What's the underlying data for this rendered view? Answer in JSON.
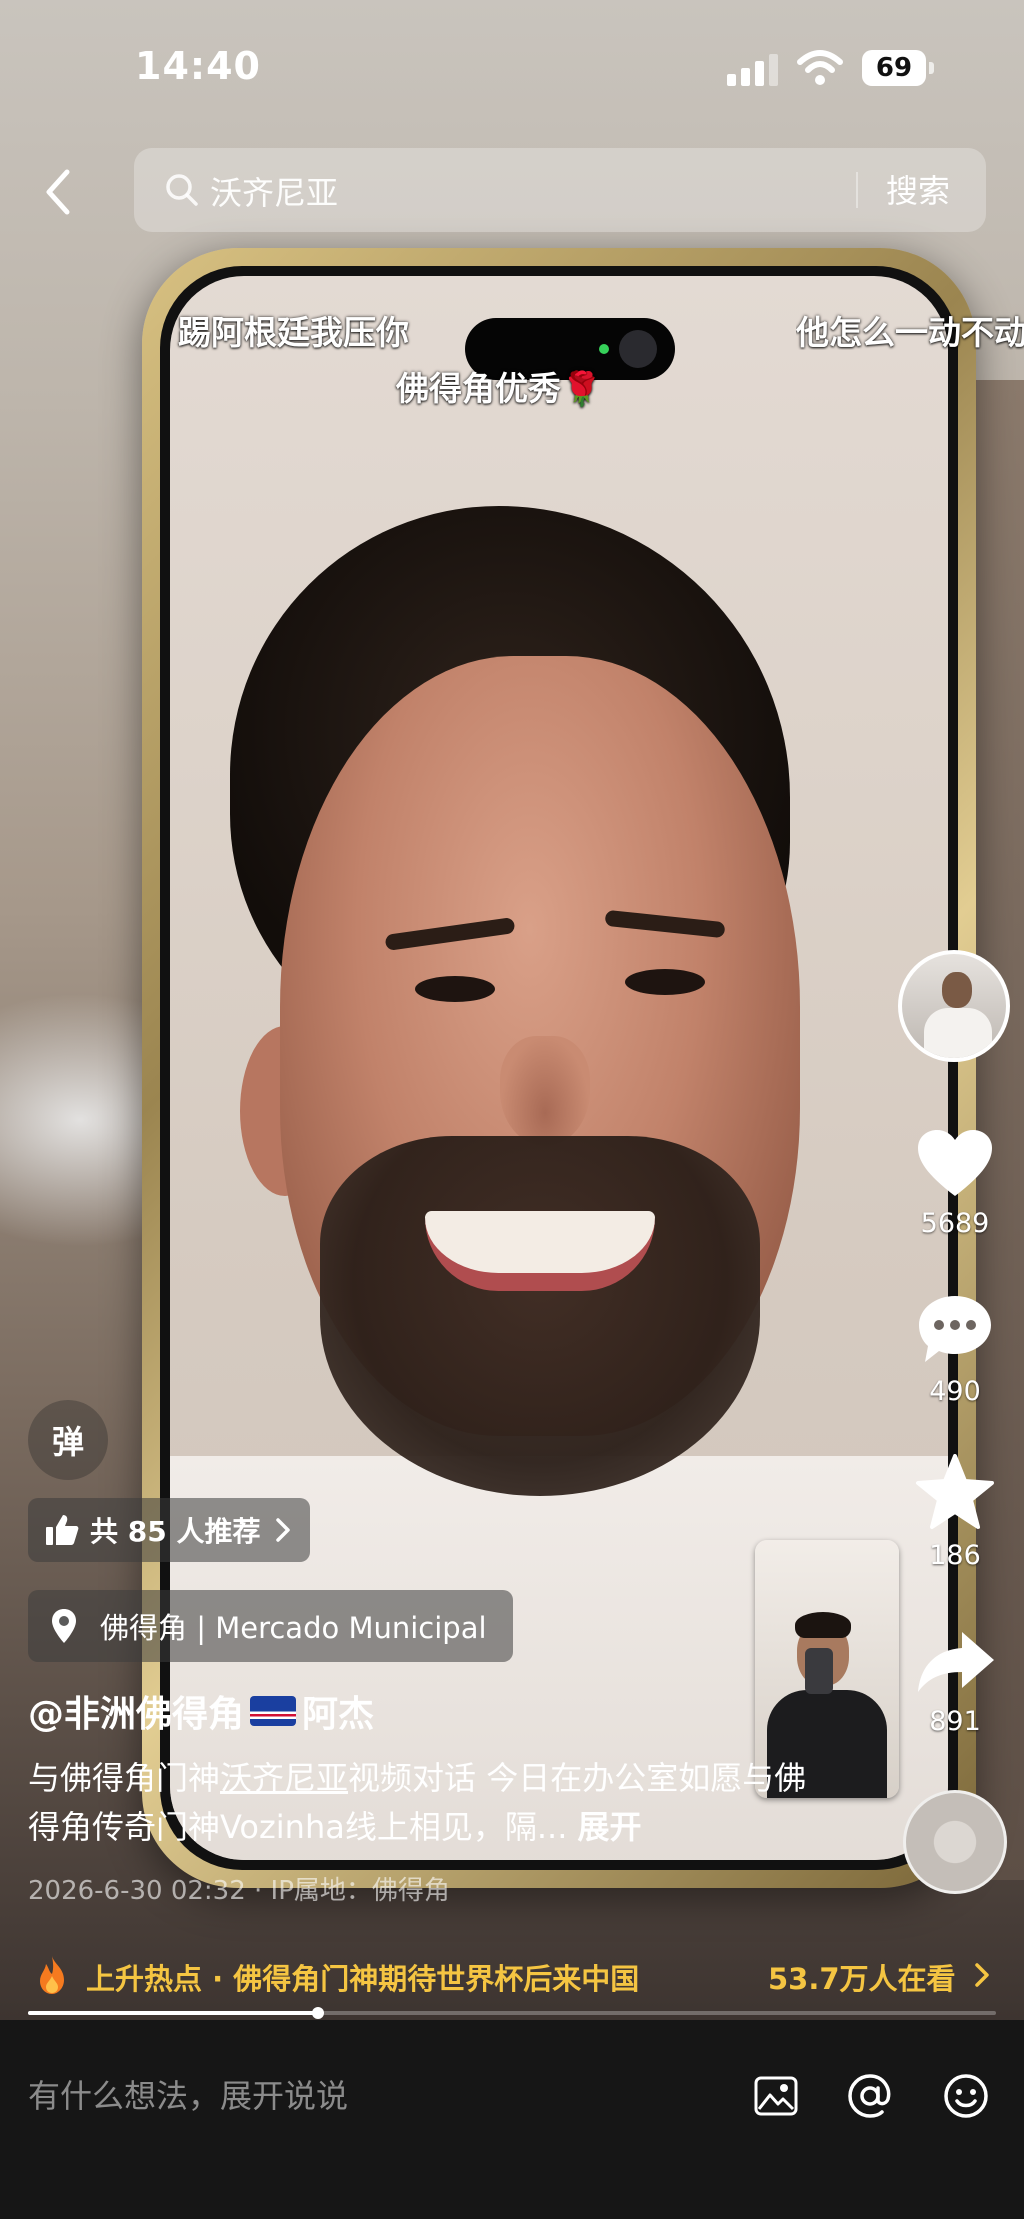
{
  "status_bar": {
    "time": "14:40",
    "battery": "69"
  },
  "search": {
    "query": "沃齐尼亚",
    "submit_label": "搜索"
  },
  "danmaku": [
    "踢阿根廷我压你",
    "他怎么一动不动",
    "佛得角优秀🌹"
  ],
  "toggles": {
    "danmu": "弹"
  },
  "actions": {
    "likes": "5689",
    "comments": "490",
    "favorites": "186",
    "shares": "891"
  },
  "recommend": {
    "label": "共 85 人推荐"
  },
  "location": {
    "label": "佛得角 | Mercado Municipal"
  },
  "post": {
    "author": "@非洲佛得角",
    "author_suffix": "阿杰",
    "desc_pre": "与佛得角门神",
    "desc_highlight": "沃齐尼亚",
    "desc_post": "视频对话 今日在办公室如愿与佛得角传奇门神Vozinha线上相见，隔...",
    "expand": "展开",
    "meta": "2026-6-30 02:32 · IP属地：佛得角"
  },
  "hot": {
    "label": "上升热点 · 佛得角门神期待世界杯后来中国",
    "viewers": "53.7万人在看"
  },
  "playback": {
    "progress": 0.3
  },
  "comment": {
    "placeholder": "有什么想法，展开说说"
  },
  "colors": {
    "hot": "#f5c542",
    "background": "#000000",
    "comment_bar": "#161616"
  }
}
